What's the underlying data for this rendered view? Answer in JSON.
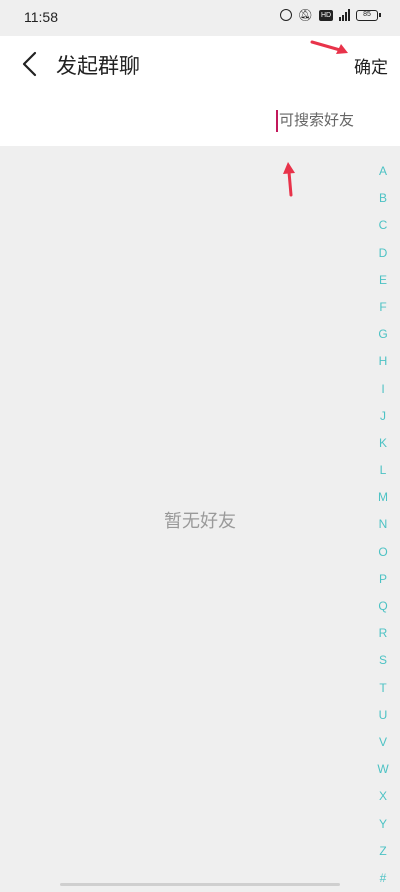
{
  "status_bar": {
    "time": "11:58",
    "hd_label": "HD",
    "battery_level": "85"
  },
  "header": {
    "title": "发起群聊",
    "confirm_label": "确定",
    "back_icon": "chevron-left-icon"
  },
  "search": {
    "placeholder": "可搜索好友",
    "value": ""
  },
  "empty_state": {
    "message": "暂无好友"
  },
  "index_bar": {
    "letters": [
      "A",
      "B",
      "C",
      "D",
      "E",
      "F",
      "G",
      "H",
      "I",
      "J",
      "K",
      "L",
      "M",
      "N",
      "O",
      "P",
      "Q",
      "R",
      "S",
      "T",
      "U",
      "V",
      "W",
      "X",
      "Y",
      "Z",
      "#"
    ],
    "color": "#4cc2c4"
  },
  "annotations": {
    "arrow_color": "#e8334a",
    "arrows": [
      "arrow-to-confirm",
      "arrow-to-search"
    ]
  }
}
